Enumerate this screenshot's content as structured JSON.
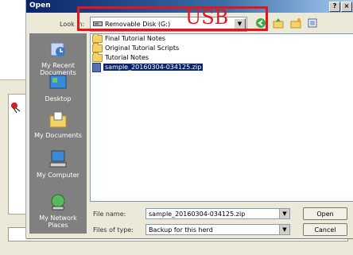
{
  "dialog": {
    "title": "Open",
    "title_buttons": [
      "?",
      "×"
    ]
  },
  "look_in": {
    "label": "Look in:",
    "value": "Removable Disk (G:)",
    "annotation": "USB"
  },
  "places": [
    {
      "label": "My Recent Documents",
      "icon": "recent-documents-icon"
    },
    {
      "label": "Desktop",
      "icon": "desktop-icon"
    },
    {
      "label": "My Documents",
      "icon": "my-documents-icon"
    },
    {
      "label": "My Computer",
      "icon": "my-computer-icon"
    },
    {
      "label": "My Network Places",
      "icon": "network-places-icon"
    }
  ],
  "files": [
    {
      "name": "Final Tutorial Notes",
      "type": "folder"
    },
    {
      "name": "Original Tutorial Scripts",
      "type": "folder"
    },
    {
      "name": "Tutorial Notes",
      "type": "folder"
    },
    {
      "name": "sample_20160304-034125.zip",
      "type": "zip",
      "selected": true
    }
  ],
  "file_name": {
    "label": "File name:",
    "value": "sample_20160304-034125.zip"
  },
  "file_type": {
    "label": "Files of type:",
    "value": "Backup for this herd"
  },
  "buttons": {
    "open": "Open",
    "cancel": "Cancel"
  },
  "colors": {
    "accent": "#0a246a",
    "annotation": "#e8141c"
  }
}
